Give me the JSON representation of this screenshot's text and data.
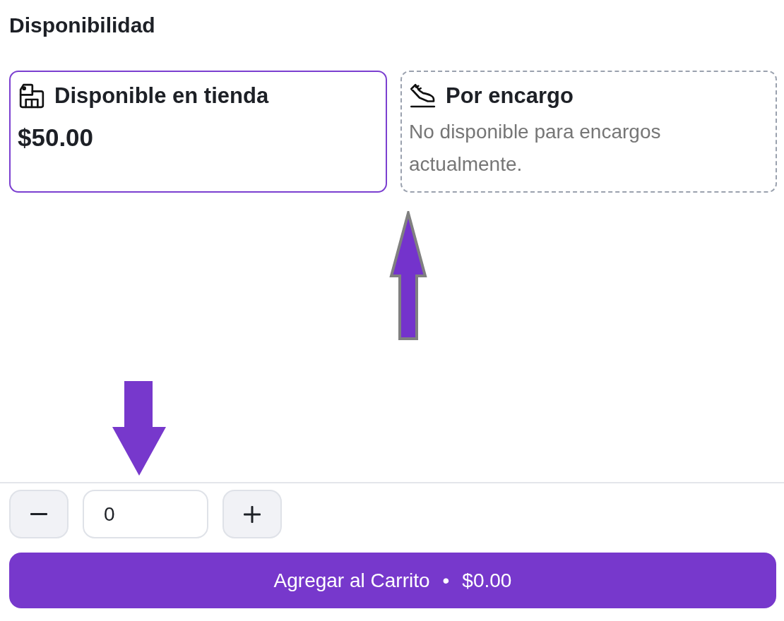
{
  "section_title": "Disponibilidad",
  "options": [
    {
      "kind": "store",
      "title": "Disponible en tienda",
      "price": "$50.00",
      "available": true
    },
    {
      "kind": "order",
      "title": "Por encargo",
      "note": "No disponible para encargos actualmente.",
      "available": false
    }
  ],
  "pointer_arrows": [
    {
      "kind": "up",
      "outlined": true
    },
    {
      "kind": "down",
      "outlined": false
    }
  ],
  "quantity": {
    "value": "0"
  },
  "cart_button": {
    "label": "Agregar al Carrito",
    "separator": "•",
    "total": "$0.00"
  }
}
